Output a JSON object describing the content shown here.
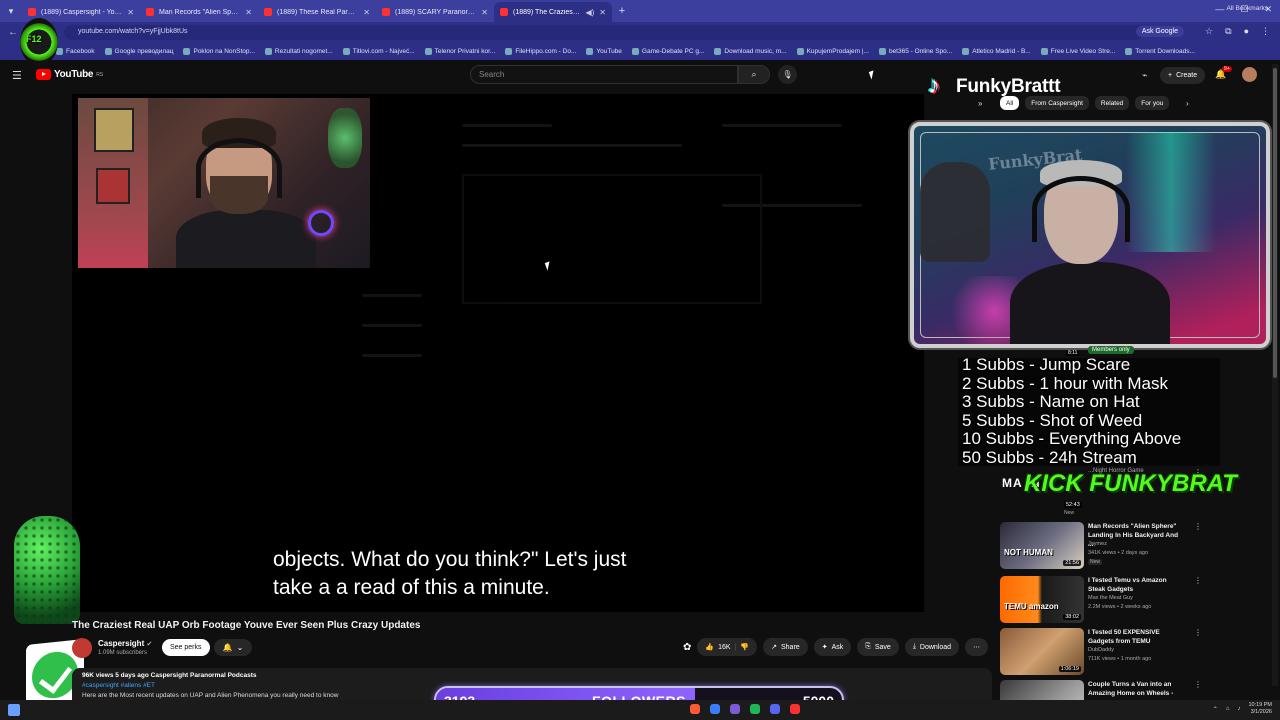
{
  "browser": {
    "tabs": [
      {
        "label": "(1889) Caspersight - YouTube",
        "active": false
      },
      {
        "label": "Man Records \"Alien Sphere\" La...",
        "active": false
      },
      {
        "label": "(1889) These Real Paranormal E...",
        "active": false
      },
      {
        "label": "(1889) SCARY Paranormal Clips...",
        "active": false
      },
      {
        "label": "(1889) The Craziest Real UA...",
        "active": true
      }
    ],
    "url": "youtube.com/watch?v=yFjjUbk8tUs",
    "ask_google": "Ask Google",
    "bookmarks": [
      "Facebook",
      "Google преводилац",
      "Poklon na NonStop...",
      "Rezultati nogomet...",
      "Titlovi.com - Najveć...",
      "Telenor Privatni kor...",
      "FileHippo.com - Do...",
      "YouTube",
      "Game-Debate PC g...",
      "Download music, m...",
      "KupujemProdajem |...",
      "bet365 - Online Spo...",
      "Atletico Madrid - B...",
      "Free Live Video Stre...",
      "Torrent Downloads..."
    ],
    "all_bookmarks": "All Bookmarks"
  },
  "youtube": {
    "logo": "YouTube",
    "region": "RS",
    "search_placeholder": "Search",
    "create_label": "Create",
    "notification_count": "9+"
  },
  "video": {
    "subtitle_line1": "objects. What do you think?\" Let's just",
    "subtitle_line2": "take a a read of this a minute.",
    "title": "The Craziest Real UAP Orb Footage Youve Ever Seen Plus Crazy Updates",
    "channel": "Caspersight",
    "subscribers": "1.09M subscribers",
    "see_perks": "See perks",
    "likes": "16K",
    "share": "Share",
    "ask": "Ask",
    "save": "Save",
    "download": "Download",
    "desc_views": "96K views  5 days ago  Caspersight Paranormal Podcasts",
    "desc_tags": "#caspersight #aliens #ET",
    "desc_text": "Here are the Most recent updates on UAP and Alien Phenomena you really need to know"
  },
  "stream_overlay": {
    "kick_badge": "F12",
    "tiktok_name": "FunkyBrattt",
    "cam_watermark": "FunkyBrat",
    "members_only": "Members only",
    "sub_goals": [
      "1 Subbs - Jump Scare",
      "2 Subbs - 1 hour with Mask",
      "3 Subbs - Name on Hat",
      "5 Subbs - Shot of Weed",
      "10 Subbs - Everything Above",
      "50 Subbs - 24h Stream"
    ],
    "followers_current": "3193",
    "followers_label": "FOLLOWERS",
    "followers_goal": "5000",
    "followers_progress": 0.6386,
    "kick_banner_text": "KICK FUNKYBRAT",
    "kick_banner_prefix": "MA IN"
  },
  "sidebar": {
    "chips": [
      "All",
      "From Caspersight",
      "Related",
      "For you"
    ],
    "top_rec_title": "...Night Horror Game",
    "top_rec_duration": "52:43",
    "top_rec_new": "New",
    "recs": [
      {
        "title": "Man Records \"Alien Sphere\" Landing In His Backyard And ...",
        "channel": "Jaymez",
        "meta": "341K views • 2 days ago",
        "badge": "New",
        "duration": "21:56",
        "thumb_text": "NOT HUMAN"
      },
      {
        "title": "I Tested Temu vs Amazon Steak Gadgets",
        "channel": "Max the Meat Guy",
        "meta": "2.2M views • 2 weeks ago",
        "badge": "",
        "duration": "38:02",
        "thumb_text": "TEMU  amazon"
      },
      {
        "title": "I Tested 50 EXPENSIVE Gadgets from TEMU",
        "channel": "DubDaddy",
        "meta": "711K views • 1 month ago",
        "badge": "",
        "duration": "1:06:19",
        "thumb_text": ""
      },
      {
        "title": "Couple Turns a Van into an Amazing Home on Wheels - ...",
        "channel": "",
        "meta": "",
        "badge": "",
        "duration": "",
        "thumb_text": ""
      }
    ]
  },
  "taskbar": {
    "time": "10:19 PM",
    "date": "3/1/2026"
  }
}
